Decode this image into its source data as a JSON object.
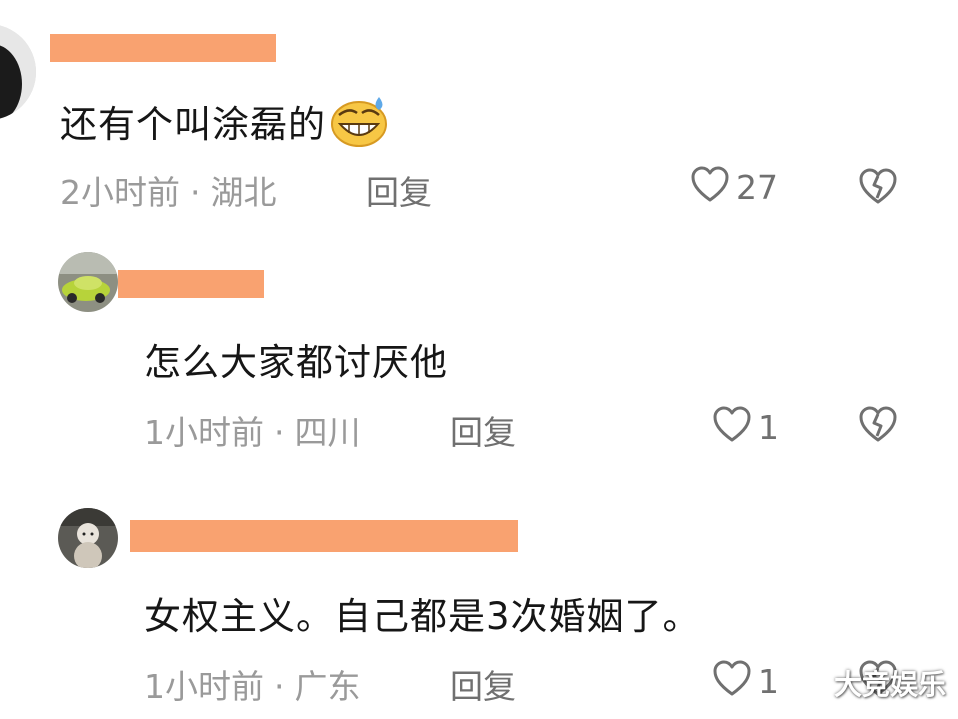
{
  "comments": [
    {
      "text": "还有个叫涂磊的",
      "emoji": "grinning-sweat-emoji",
      "time": "2小时前",
      "separator": "·",
      "location": "湖北",
      "reply_label": "回复",
      "like_count": "27"
    },
    {
      "text": "怎么大家都讨厌他",
      "time": "1小时前",
      "separator": "·",
      "location": "四川",
      "reply_label": "回复",
      "like_count": "1"
    },
    {
      "text": "女权主义。自己都是3次婚姻了。",
      "time": "1小时前",
      "separator": "·",
      "location": "广东",
      "reply_label": "回复",
      "like_count": "1"
    }
  ],
  "watermark": "大竞娱乐",
  "colors": {
    "redaction": "#f9a270",
    "meta_text": "#9a9a9a",
    "icon": "#707070"
  },
  "icons": {
    "like": "heart-outline-icon",
    "dislike": "broken-heart-icon"
  }
}
